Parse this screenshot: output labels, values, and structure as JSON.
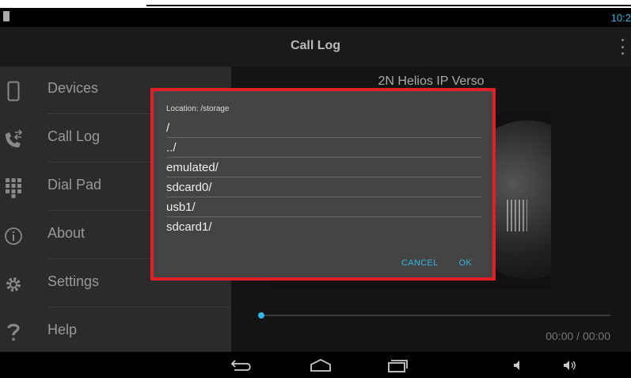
{
  "status": {
    "clock": "10:2"
  },
  "actionbar": {
    "title": "Call Log"
  },
  "sidebar": {
    "items": [
      {
        "label": "Devices",
        "icon": "phone-icon"
      },
      {
        "label": "Call Log",
        "icon": "call-log-icon"
      },
      {
        "label": "Dial Pad",
        "icon": "dialpad-icon"
      },
      {
        "label": "About",
        "icon": "info-icon"
      },
      {
        "label": "Settings",
        "icon": "gear-icon"
      },
      {
        "label": "Help",
        "icon": "help-icon"
      }
    ]
  },
  "main": {
    "device_title": "2N Helios IP Verso",
    "time": "00:00 / 00:00",
    "seek_progress": 0
  },
  "dialog": {
    "location": "Location: /storage",
    "files": [
      "/",
      "../",
      "emulated/",
      "sdcard0/",
      "usb1/",
      "sdcard1/"
    ],
    "cancel_label": "CANCEL",
    "ok_label": "OK"
  },
  "colors": {
    "accent": "#33b5e5",
    "highlight_border": "#e31e24"
  }
}
